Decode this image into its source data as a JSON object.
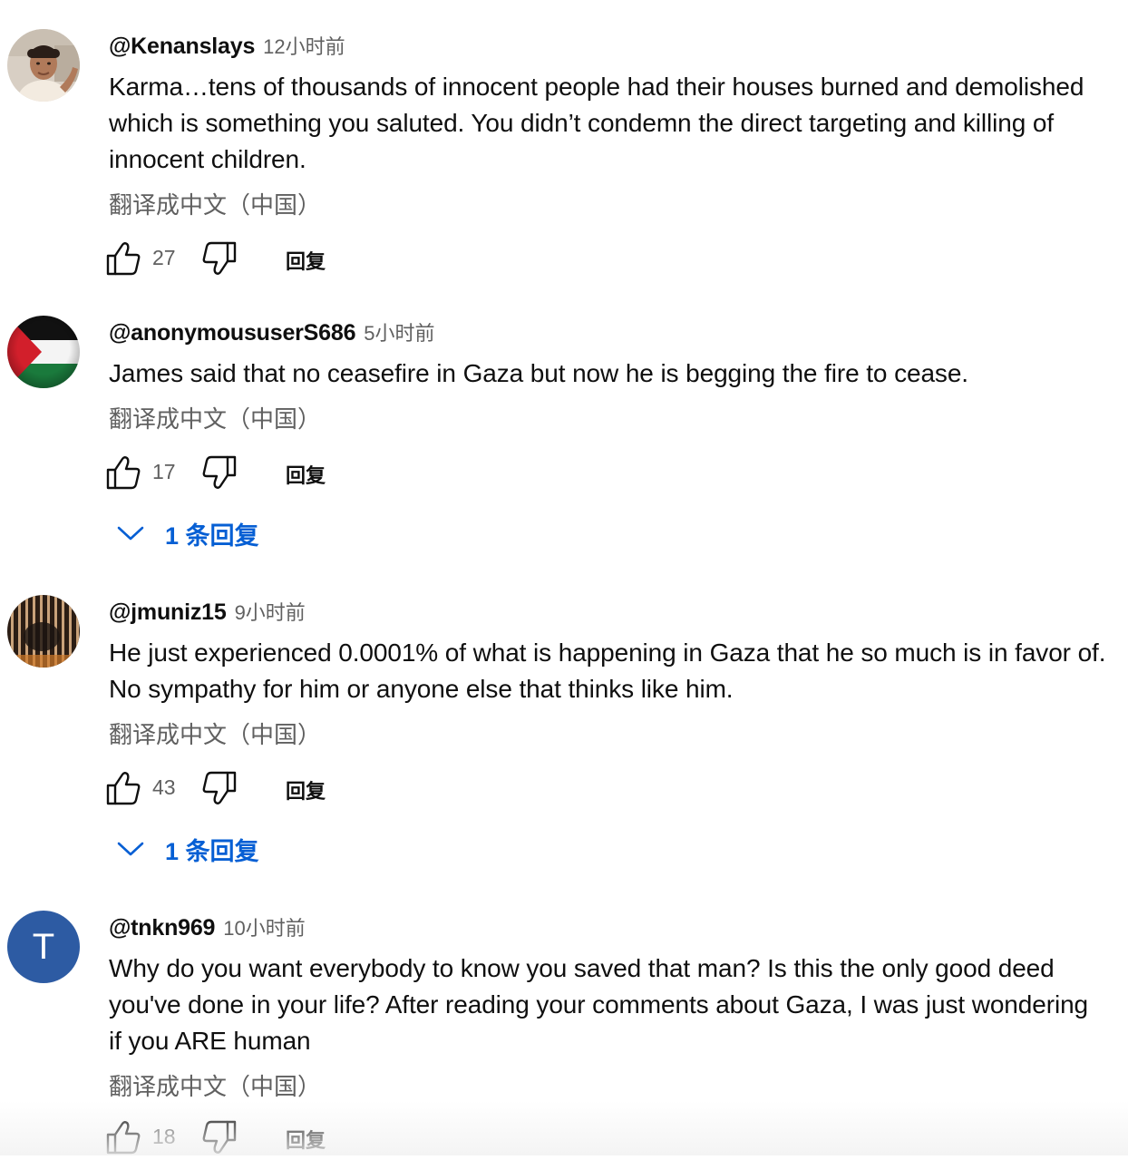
{
  "comments": [
    {
      "author": "@Kenanslays",
      "time": "12小时前",
      "text": "Karma…tens of thousands of innocent people had their houses burned and demolished which is something you saluted. You didn’t condemn the direct targeting and killing of innocent children.",
      "translate": "翻译成中文（中国）",
      "likes": "27",
      "reply": "回复",
      "avatar_icon": "user-photo-avatar"
    },
    {
      "author": "@anonymoususerS686",
      "time": "5小时前",
      "text": "James said that no ceasefire in Gaza but now he is begging the fire to cease.",
      "translate": "翻译成中文（中国）",
      "likes": "17",
      "reply": "回复",
      "replies_count": "1 条回复",
      "avatar_icon": "palestine-flag-avatar"
    },
    {
      "author": "@jmuniz15",
      "time": "9小时前",
      "text": "He just experienced 0.0001% of what is happening in Gaza that he so much is in favor of. No sympathy for him or anyone else that thinks like him.",
      "translate": "翻译成中文（中国）",
      "likes": "43",
      "reply": "回复",
      "replies_count": "1 条回复",
      "avatar_icon": "dark-striped-avatar"
    },
    {
      "author": "@tnkn969",
      "time": "10小时前",
      "text": "Why do you want everybody to know you saved that man? Is this the only good deed you've done in your life? After reading your comments about Gaza, I was just wondering if you ARE human",
      "translate": "翻译成中文（中国）",
      "likes": "18",
      "reply": "回复",
      "avatar_letter": "T",
      "avatar_icon": "letter-avatar"
    }
  ],
  "colors": {
    "text": "#0f0f0f",
    "secondary": "#606060",
    "link": "#065fd4",
    "letter_avatar_bg": "#2d5ba3"
  }
}
